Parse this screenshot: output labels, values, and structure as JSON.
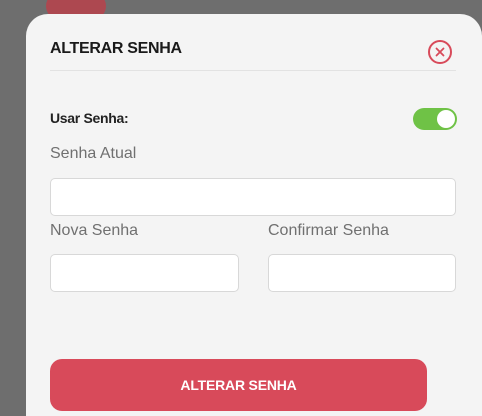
{
  "modal": {
    "title": "ALTERAR SENHA",
    "close_icon": "close-circle-icon",
    "use_password": {
      "label": "Usar Senha:",
      "enabled": true
    },
    "current_password": {
      "label": "Senha Atual",
      "value": "",
      "placeholder": ""
    },
    "new_password": {
      "label": "Nova Senha",
      "value": "",
      "placeholder": ""
    },
    "confirm_password": {
      "label": "Confirmar Senha",
      "value": "",
      "placeholder": ""
    },
    "submit_label": "ALTERAR SENHA"
  },
  "colors": {
    "accent": "#d84a5a",
    "toggle_on": "#6fc246",
    "backdrop": "#6e6e6e",
    "modal_bg": "#f4f4f4"
  }
}
